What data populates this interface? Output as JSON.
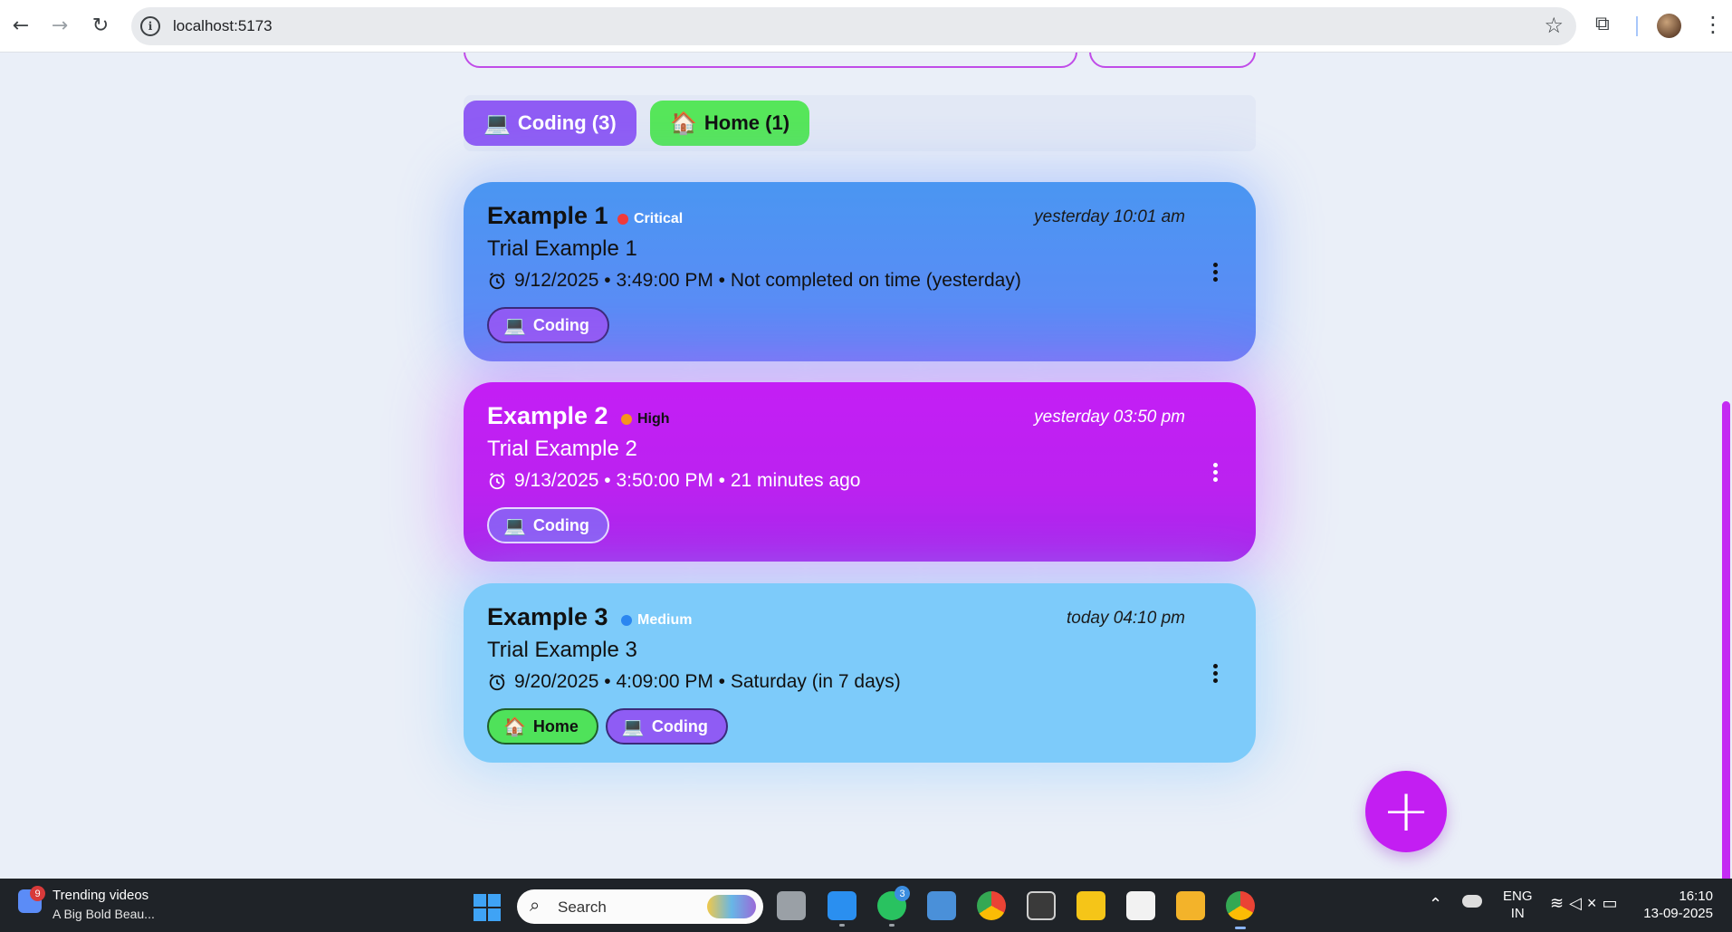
{
  "browser": {
    "url": "localhost:5173"
  },
  "filters": [
    {
      "emoji": "💻",
      "label": "Coding (3)",
      "color": "#8f5cf4"
    },
    {
      "emoji": "🏠",
      "label": "Home (1)",
      "color": "#56e65a"
    }
  ],
  "tasks": [
    {
      "title": "Example 1",
      "priority": "Critical",
      "priority_color": "#f03a3a",
      "created": "yesterday 10:01 am",
      "description": "Trial Example 1",
      "due": "9/12/2025 • 3:49:00 PM • Not completed on time (yesterday)",
      "tags": [
        {
          "emoji": "💻",
          "label": "Coding"
        }
      ]
    },
    {
      "title": "Example 2",
      "priority": "High",
      "priority_color": "#f5951c",
      "created": "yesterday 03:50 pm",
      "description": "Trial Example 2",
      "due": "9/13/2025 • 3:50:00 PM • 21 minutes ago",
      "tags": [
        {
          "emoji": "💻",
          "label": "Coding"
        }
      ]
    },
    {
      "title": "Example 3",
      "priority": "Medium",
      "priority_color": "#2b86f0",
      "created": "today 04:10 pm",
      "description": "Trial Example 3",
      "due": "9/20/2025 • 4:09:00 PM • Saturday (in 7 days)",
      "tags": [
        {
          "emoji": "🏠",
          "label": "Home"
        },
        {
          "emoji": "💻",
          "label": "Coding"
        }
      ]
    }
  ],
  "fab": {
    "label": "+"
  },
  "taskbar": {
    "news_title": "Trending videos",
    "news_subtitle": "A Big Bold Beau...",
    "news_badge": "9",
    "search_label": "Search",
    "whatsapp_badge": "3",
    "lang_top": "ENG",
    "lang_bottom": "IN",
    "time": "16:10",
    "date": "13-09-2025"
  }
}
